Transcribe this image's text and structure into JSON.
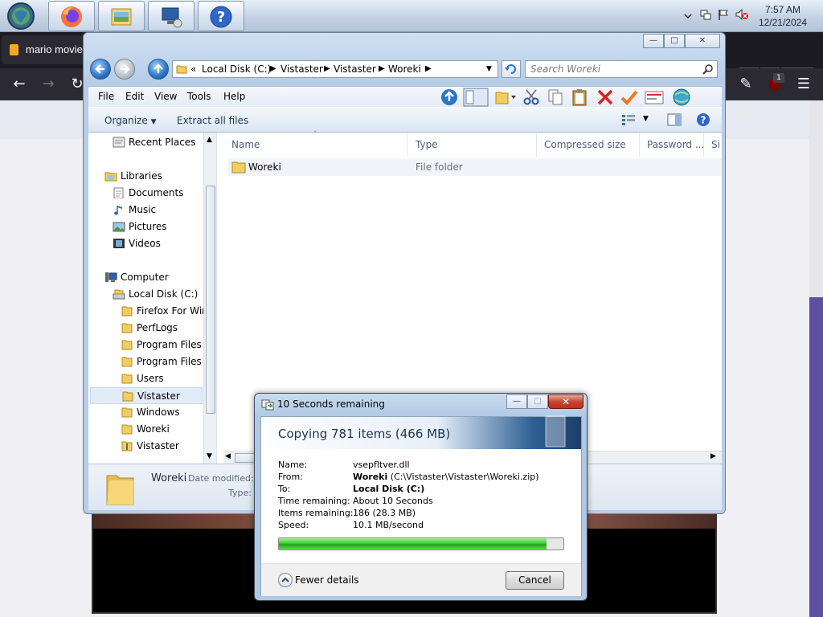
{
  "taskbar": {
    "clock_time": "7:57 AM",
    "clock_date": "12/21/2024",
    "pinned": [
      "firefox-icon",
      "explorer-icon",
      "network-icon",
      "help-icon"
    ]
  },
  "browser": {
    "tab_title": "mario movie",
    "notification_count": "1"
  },
  "explorer": {
    "address": {
      "overflow": "«",
      "crumbs": [
        "Local Disk (C:)",
        "Vistaster",
        "Vistaster",
        "Woreki"
      ]
    },
    "search_placeholder": "Search Woreki",
    "menu": [
      "File",
      "Edit",
      "View",
      "Tools",
      "Help"
    ],
    "commands": {
      "organize": "Organize",
      "extract": "Extract all files"
    },
    "nav": {
      "recent_places": "Recent Places",
      "libraries": "Libraries",
      "documents": "Documents",
      "music": "Music",
      "pictures": "Pictures",
      "videos": "Videos",
      "computer": "Computer",
      "local_disk": "Local Disk (C:)",
      "folders": [
        "Firefox For Win",
        "PerfLogs",
        "Program Files",
        "Program Files (",
        "Users",
        "Vistaster",
        "Windows",
        "Woreki",
        "Vistaster"
      ],
      "selected": "Vistaster"
    },
    "columns": {
      "name": "Name",
      "type": "Type",
      "compressed_size": "Compressed size",
      "password": "Password ...",
      "size_trunc": "Si"
    },
    "files": [
      {
        "name": "Woreki",
        "type": "File folder"
      }
    ],
    "details": {
      "name": "Woreki",
      "date_label": "Date modified:",
      "type_label": "Type:"
    }
  },
  "copy_dialog": {
    "title": "10 Seconds remaining",
    "heading": "Copying 781 items (466 MB)",
    "rows": {
      "name_label": "Name:",
      "name_value": "vsepfltver.dll",
      "from_label": "From:",
      "from_bold": "Woreki",
      "from_rest": " (C:\\Vistaster\\Vistaster\\Woreki.zip)",
      "to_label": "To:",
      "to_value": "Local Disk (C:)",
      "time_label": "Time remaining:",
      "time_value": "About 10 Seconds",
      "items_label": "Items remaining:",
      "items_value": "186 (28.3 MB)",
      "speed_label": "Speed:",
      "speed_value": "10.1 MB/second"
    },
    "progress_percent": 94,
    "fewer_details": "Fewer details",
    "cancel": "Cancel"
  }
}
